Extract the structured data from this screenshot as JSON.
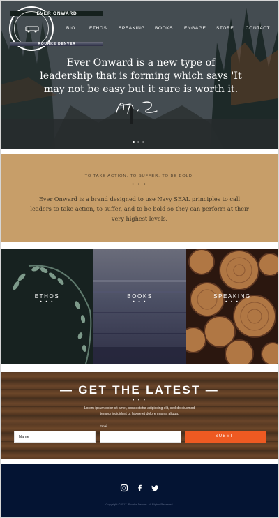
{
  "logo": {
    "top_text": "EVER ONWARD",
    "bottom_text": "ROURKE DENVER"
  },
  "nav": [
    "BIO",
    "ETHOS",
    "SPEAKING",
    "BOOKS",
    "ENGAGE",
    "STORE",
    "CONTACT"
  ],
  "hero": {
    "quote": "Ever Onward is a new type of leadership that is forming which says 'It may not be easy but it sure is worth it."
  },
  "brand": {
    "tagline": "TO TAKE ACTION. TO SUFFER. TO BE BOLD.",
    "dots": "• • •",
    "text": "Ever Onward is a brand designed to use Navy SEAL principles to call leaders to take action, to suffer, and to be bold so they can perform at their very highest levels."
  },
  "tiles": [
    {
      "label": "ETHOS",
      "dots": "• • •"
    },
    {
      "label": "BOOKS",
      "dots": "• • •"
    },
    {
      "label": "SPEAKING",
      "dots": "• • •"
    }
  ],
  "newsletter": {
    "heading": "— GET THE LATEST —",
    "dots": "• • •",
    "text": "Lorem ipsum dolor sit amet, consectetur adipiscing elit, sed do eiusmod tempor incididunt ut labore et dolore magna aliqua.",
    "name_value": "Name",
    "email_label": "Email",
    "email_value": "",
    "submit_label": "SUBMIT"
  },
  "footer": {
    "social_icons": [
      "instagram-icon",
      "facebook-icon",
      "twitter-icon"
    ],
    "copyright": "Copyright ©2017. Rourke Denver. All Rights Reserved."
  },
  "colors": {
    "brand": "#c79e69",
    "submit": "#ee5a22",
    "footer": "#041433"
  }
}
